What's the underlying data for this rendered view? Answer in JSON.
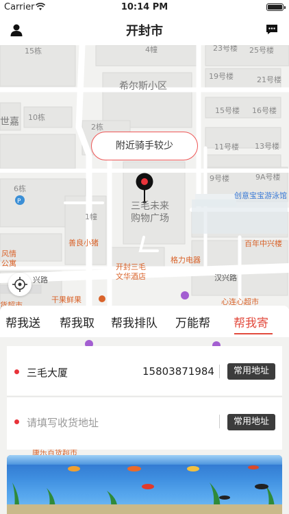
{
  "status_bar": {
    "carrier": "Carrier",
    "time": "10:14 PM"
  },
  "nav": {
    "title": "开封市"
  },
  "map": {
    "labels": {
      "b15": "15栋",
      "b4": "4幢",
      "b23": "23号楼",
      "b25": "25号楼",
      "xiersi": "希尔斯小区",
      "b19": "19号楼",
      "b21": "21号楼",
      "shijia": "世嘉",
      "b10": "10栋",
      "b15h": "15号楼",
      "b16": "16号楼",
      "b2": "2栋",
      "b11": "11号楼",
      "b13": "13号楼",
      "b9": "9号楼",
      "b9a": "9A号楼",
      "swim": "创意宝宝游泳馆",
      "b6": "6栋",
      "b1": "1幢",
      "mall": "三毛未来\n购物广场",
      "pig": "善良小猪",
      "bainian": "百年中兴楼",
      "fengqing": "风情\n公寓",
      "hotel": "开封三毛\n文华酒店",
      "gree": "格力电器",
      "xinglu": "兴路",
      "hanxinglu": "汉兴路",
      "fruit": "干果鲜果",
      "supermarket_left": "货超市",
      "xinlian": "心连心超市",
      "kangle": "康乐百货超市"
    },
    "riders_text": "附近骑手较少"
  },
  "tabs": [
    {
      "label": "帮我送"
    },
    {
      "label": "帮我取"
    },
    {
      "label": "帮我排队"
    },
    {
      "label": "万能帮"
    },
    {
      "label": "帮我寄",
      "active": true
    }
  ],
  "sender": {
    "name": "三毛大厦",
    "phone": "15803871984",
    "button": "常用地址"
  },
  "receiver": {
    "placeholder": "请填写收货地址",
    "button": "常用地址"
  },
  "colors": {
    "accent": "#e24a3d",
    "dot": "#e8333a",
    "button_bg": "#3c3c3c"
  }
}
